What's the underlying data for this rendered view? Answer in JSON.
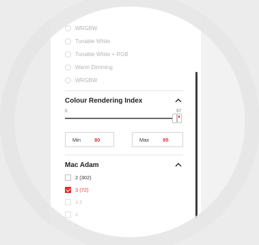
{
  "lighting_options": [
    {
      "label": "WRGBW"
    },
    {
      "label": "Tunable White"
    },
    {
      "label": "Tunable White + RGB"
    },
    {
      "label": "Warm Dimming"
    },
    {
      "label": "WRGBW"
    }
  ],
  "cri": {
    "title": "Colour Rendering Index",
    "slider_min_label": "0",
    "slider_max_label": "97",
    "range_min": 0,
    "range_max": 97,
    "handle_value": 97,
    "min_label": "Min",
    "min_value": "80",
    "max_label": "Max",
    "max_value": "95"
  },
  "mac_adam": {
    "title": "Mac Adam",
    "items": [
      {
        "label": "2 (302)",
        "checked": false
      },
      {
        "label": "3 (72)",
        "checked": true
      },
      {
        "label": "3.5",
        "checked": false
      },
      {
        "label": "4",
        "checked": false
      },
      {
        "label": "5",
        "checked": false
      }
    ]
  },
  "colors": {
    "accent": "#e03030",
    "text": "#222222",
    "muted": "#b4b4b4"
  },
  "icons": {
    "collapse": "chevron-up-icon"
  }
}
